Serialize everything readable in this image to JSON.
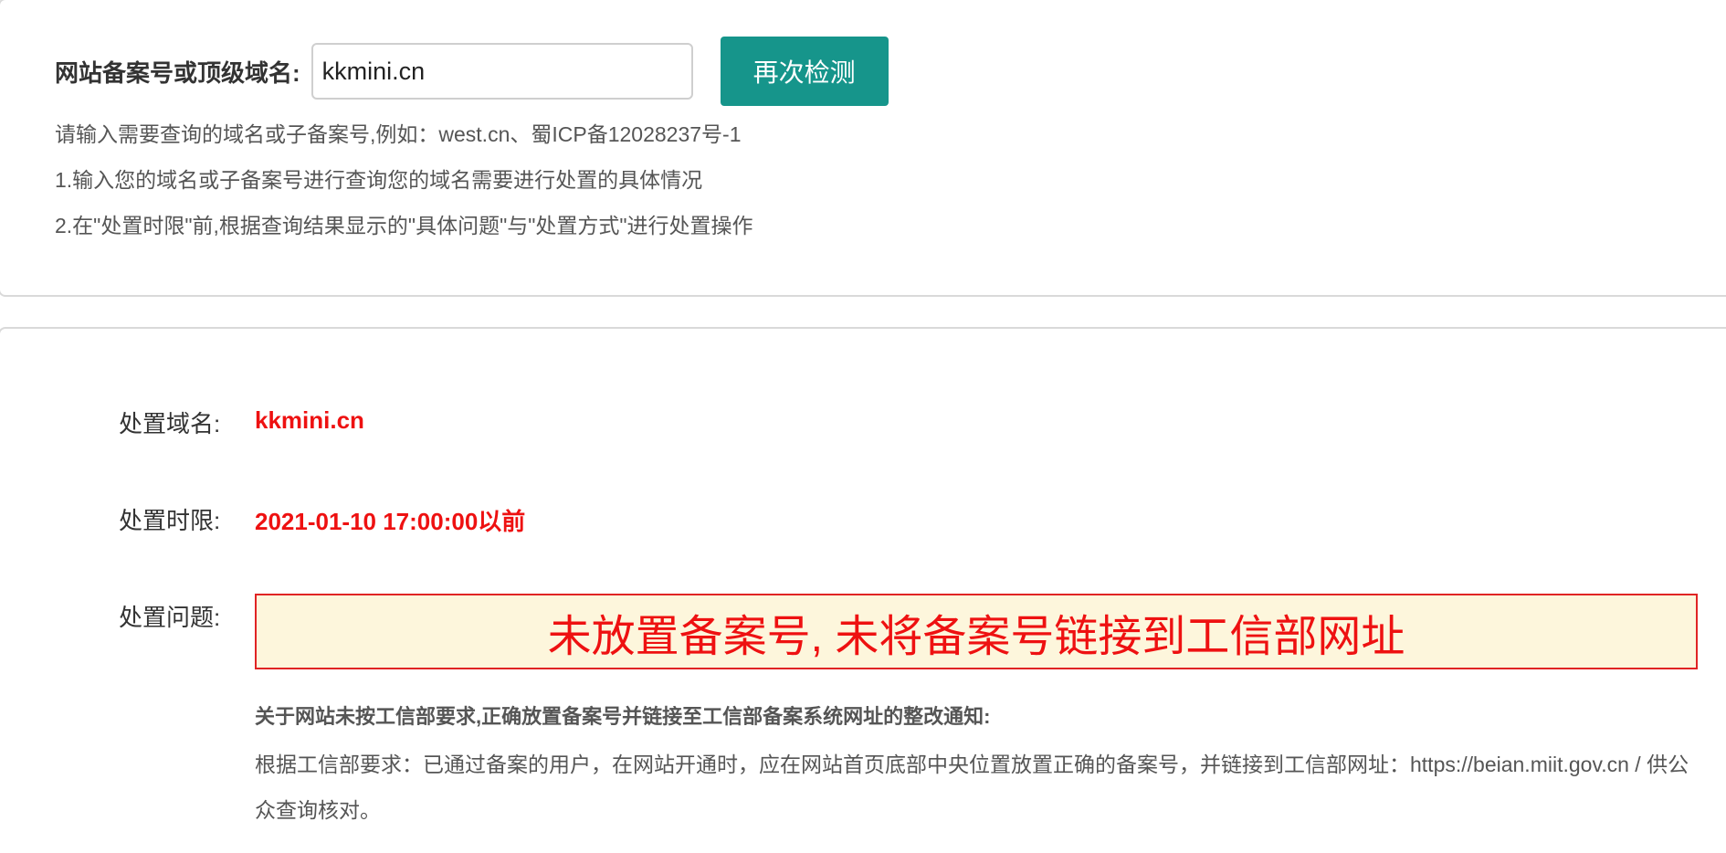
{
  "search": {
    "label": "网站备案号或顶级域名:",
    "input_value": "kkmini.cn",
    "button_label": "再次检测",
    "hints": [
      "请输入需要查询的域名或子备案号,例如：west.cn、蜀ICP备12028237号-1",
      "1.输入您的域名或子备案号进行查询您的域名需要进行处置的具体情况",
      "2.在\"处置时限\"前,根据查询结果显示的\"具体问题\"与\"处置方式\"进行处置操作"
    ]
  },
  "result": {
    "domain_label": "处置域名:",
    "domain_value": "kkmini.cn",
    "deadline_label": "处置时限:",
    "deadline_value": "2021-01-10 17:00:00以前",
    "issue_label": "处置问题:",
    "issue_text": "未放置备案号, 未将备案号链接到工信部网址",
    "notice_title": "关于网站未按工信部要求,正确放置备案号并链接至工信部备案系统网址的整改通知:",
    "notice_body": "根据工信部要求：已通过备案的用户，在网站开通时，应在网站首页底部中央位置放置正确的备案号，并链接到工信部网址：https://beian.miit.gov.cn / 供公众查询核对。"
  },
  "colors": {
    "accent_button": "#16958b",
    "alert_red": "#ee1111",
    "issue_background": "#fdf6dc"
  }
}
